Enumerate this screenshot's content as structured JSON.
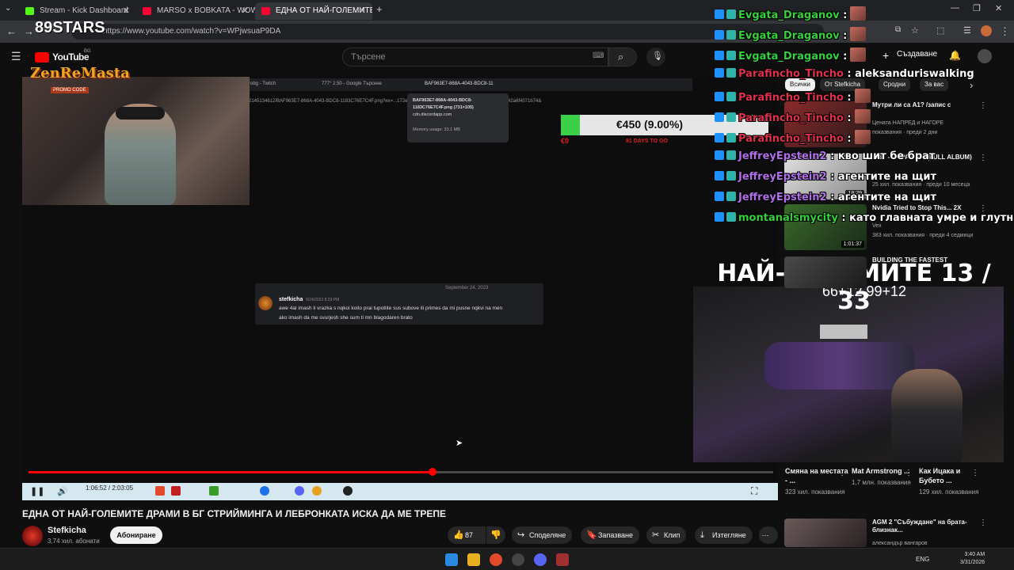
{
  "browser": {
    "tabs": [
      {
        "label": "Stream - Kick Dashboard",
        "color": "#53fc18"
      },
      {
        "label": "MARSO x BOBKATA - WOW [OF",
        "color": "#ff0033"
      },
      {
        "label": "ЕДНА ОТ НАЙ-ГОЛЕМИТЕ",
        "color": "#ff0033"
      }
    ],
    "url": "https://www.youtube.com/watch?v=WPjwsuaP9DA"
  },
  "youtube": {
    "logo": "YouTube",
    "logo_region": "BG",
    "search_placeholder": "Търсене",
    "create_label": "Създаване"
  },
  "video": {
    "inner_tabs": [
      "robg - Twitch",
      "777° 2.50 - Google Търсене",
      "BAF963E7-868A-4043-BDC8-11"
    ],
    "inner_url": "2145134612/BAF963E7-868A-4043-BDC8-1183C76E7C4F.png?ex=...172e9ef68a0654f9d02b9b2e96f9951b33ab4f19dbbc42a6f4071b74&",
    "tooltip": {
      "title": "BAF963E7-868A-4043-BDC8-1183C76E7C4F.png (731×105)",
      "host": "cdn.discordapp.com",
      "memory": "Memory usage: 33.1 MB"
    },
    "discord": {
      "date": "September 24, 2023",
      "user": "stefkicha",
      "timestamp": "9/24/2023 8:29 PM",
      "text1": "awe 4al imash li vrazka s nqkoi koito prai tupotiite sus subove ili primes da mi pusne nqkvi na men",
      "text2": "ako imash da me svurjesh she sum ti mn blagodaren brato"
    },
    "goal": {
      "amount": "€450 (9.00%)",
      "fraction": 0.09,
      "caption_left": "€0",
      "caption_right": "91 DAYS TO GO"
    },
    "promo": {
      "brand": "89STARS",
      "name": "ZenReMasta",
      "code_label": "PROMO CODE"
    },
    "counter": "НАЙ-ГОЛЕМИТЕ 13 / 33",
    "counter_sub": "66+12 99+12",
    "time_current": "1:06:52",
    "time_total": "2:03:05",
    "progress": 0.543,
    "title": "ЕДНА ОТ НАЙ-ГОЛЕМИТЕ ДРАМИ В БГ СТРИЙМИНГА И ЛЕБРОНКАТА ИСКА ДА МЕ ТРЕПЕ",
    "channel": "Stefkicha",
    "subscribers": "3,74 хил. абонати",
    "subscribe_label": "Абониране",
    "likes": "87",
    "share": "Споделяне",
    "save": "Запазване",
    "clip": "Клип",
    "download": "Изтегляне"
  },
  "chips": [
    "Всички",
    "От Stefkicha",
    "Сродни",
    "За вас"
  ],
  "recommendations": [
    {
      "title": "Мутри ли са A1? /запис с",
      "channel": "Цената НАПРЕД и НАГОРЕ",
      "views": "показвания · преди 2 дни",
      "duration": "",
      "thumb": "#7a2a2a"
    },
    {
      "title": "MBT - DOPAMINA (FULL ALBUM)",
      "channel": "",
      "views": "25 хил. показвания · преди 10 месеца",
      "duration": "18:29",
      "thumb": "#d8d8d8"
    },
    {
      "title": "Nvidia Tried to Stop This... 2X",
      "channel": "Vex",
      "views": "383 хил. показвания · преди 4 седмици",
      "duration": "1:01:37",
      "thumb": "#2d5a2a"
    },
    {
      "title": "BUILDING THE FASTEST",
      "channel": "",
      "views": "",
      "duration": "",
      "thumb": "#3a3a3a"
    }
  ],
  "shorts": [
    {
      "title": "Смяна на местата - ...",
      "views": "323 хил. показвания"
    },
    {
      "title": "Mat Armstrong ...",
      "views": "1,7 млн. показвания"
    },
    {
      "title": "Как Ицака и Бубето ...",
      "views": "129 хил. показвания"
    }
  ],
  "rec_bottom": {
    "title": "AGM 2 \"Събуждане\" на брата-близнак...",
    "channel": "александър вангаров"
  },
  "chat": [
    {
      "user": "Evgata_Draganov",
      "color": "#35d13c",
      "text": ":",
      "emote": true
    },
    {
      "user": "Evgata_Draganov",
      "color": "#35d13c",
      "text": ":",
      "emote": true
    },
    {
      "user": "Evgata_Draganov",
      "color": "#35d13c",
      "text": ":",
      "emote": true
    },
    {
      "user": "Parafincho_Tincho",
      "color": "#e0304a",
      "text": ": aleksanduriswalking",
      "emote": false
    },
    {
      "user": "Parafincho_Tincho",
      "color": "#e0304a",
      "text": ":",
      "emote": true
    },
    {
      "user": "Parafincho_Tincho",
      "color": "#e0304a",
      "text": ":",
      "emote": true
    },
    {
      "user": "Parafincho_Tincho",
      "color": "#e0304a",
      "text": ":",
      "emote": true
    },
    {
      "user": "JeffreyEpstein2",
      "color": "#b06ee8",
      "text": ": кво шит бе брат",
      "emote": false
    },
    {
      "user": "JeffreyEpstein2",
      "color": "#b06ee8",
      "text": ": агентите на щит",
      "emote": false
    },
    {
      "user": "JeffreyEpstein2",
      "color": "#b06ee8",
      "text": ": агентите на щит",
      "emote": false
    },
    {
      "user": "montanalsmycity",
      "color": "#35d13c",
      "text": ": като главната умре и глутни",
      "emote": false
    }
  ],
  "system": {
    "lang": "ENG",
    "time": "3:40 AM",
    "date": "3/31/2026"
  }
}
